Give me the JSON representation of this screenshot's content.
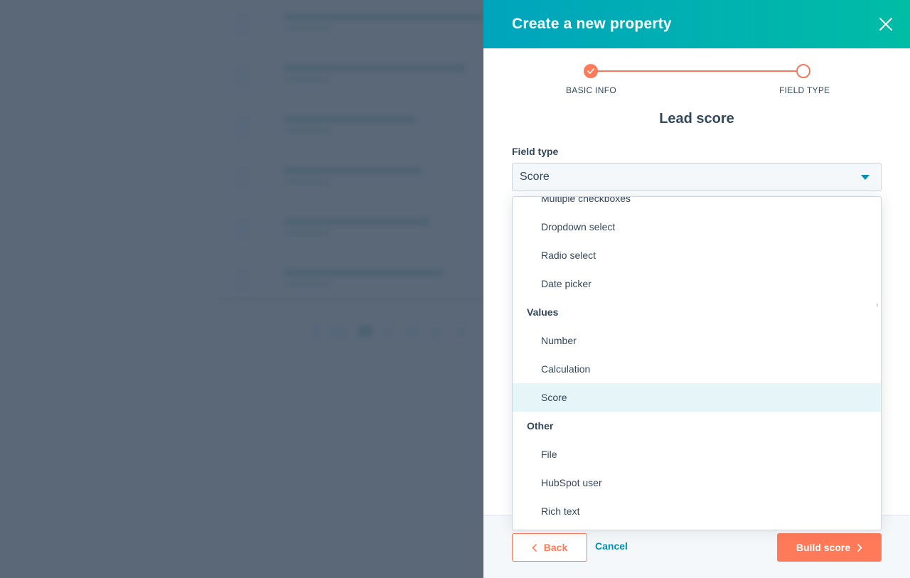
{
  "panel": {
    "title": "Create a new property",
    "close_icon": "close-icon",
    "stepper": {
      "steps": [
        {
          "label": "BASIC INFO",
          "status": "complete"
        },
        {
          "label": "FIELD TYPE",
          "status": "current"
        }
      ]
    },
    "section_title": "Lead score",
    "field_type": {
      "label": "Field type",
      "value": "Score"
    },
    "dropdown": {
      "groups": [
        {
          "label": null,
          "items": [
            "Multiple checkboxes",
            "Dropdown select",
            "Radio select",
            "Date picker"
          ]
        },
        {
          "label": "Values",
          "items": [
            "Number",
            "Calculation",
            "Score"
          ]
        },
        {
          "label": "Other",
          "items": [
            "File",
            "HubSpot user",
            "Rich text"
          ]
        }
      ],
      "selected": "Score"
    },
    "footer": {
      "back_label": "Back",
      "cancel_label": "Cancel",
      "build_label": "Build score"
    }
  },
  "colors": {
    "header_gradient_start": "#00a4bd",
    "header_gradient_end": "#00bda5",
    "accent_orange": "#ff7a59",
    "link_teal": "#0091ae",
    "selected_bg": "#e5f5f8",
    "text_dark": "#33475b",
    "overlay": "#5b6878"
  }
}
